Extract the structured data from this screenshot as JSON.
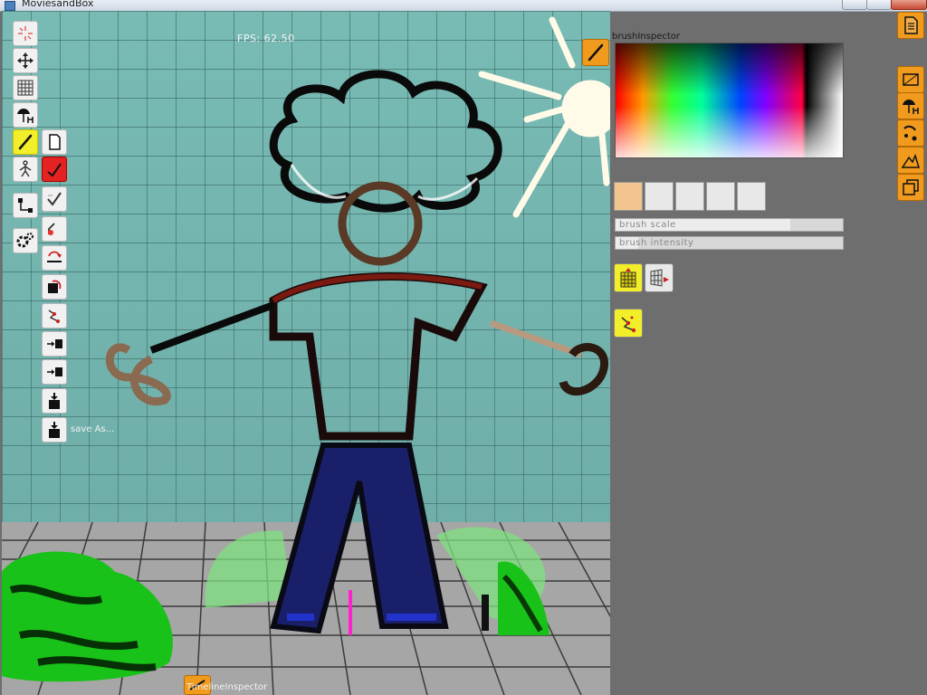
{
  "window": {
    "title": "MoviesandBox"
  },
  "viewport": {
    "fps_label": "FPS: 62.50"
  },
  "toolbar": {
    "save_label": "save As..."
  },
  "brush_inspector": {
    "title": "brushInspector",
    "slider_scale_label": "brush scale",
    "slider_scale_value": 0.77,
    "slider_intensity_label": "brush intensity",
    "slider_intensity_value": 0.1,
    "active_color": "#f2c48e",
    "swatch_count": 5
  },
  "timeline_inspector": {
    "title": "TimelineInspector"
  },
  "colors": {
    "accent_orange": "#f09a1e",
    "highlight_yellow": "#f2ee2a",
    "active_red": "#e52222",
    "panel_gray": "#6e6e6e"
  },
  "icons": {
    "left_tools": [
      "select-icon",
      "move-icon",
      "grid-icon",
      "parachute-icon",
      "brush-icon",
      "page-icon",
      "skeleton-icon",
      "draw-red-icon",
      "bone-icon",
      "pen-curve-icon",
      "settings-icon",
      "pick-icon",
      "flip-icon",
      "rotate-icon",
      "scatter-icon",
      "merge-left-icon",
      "merge-left-icon",
      "save-icon",
      "save-as-icon"
    ],
    "right_tools": [
      "page-list-icon",
      "layer-icon",
      "parachute-icon",
      "paint-icon",
      "mountain-icon",
      "duplicate-icon"
    ]
  }
}
